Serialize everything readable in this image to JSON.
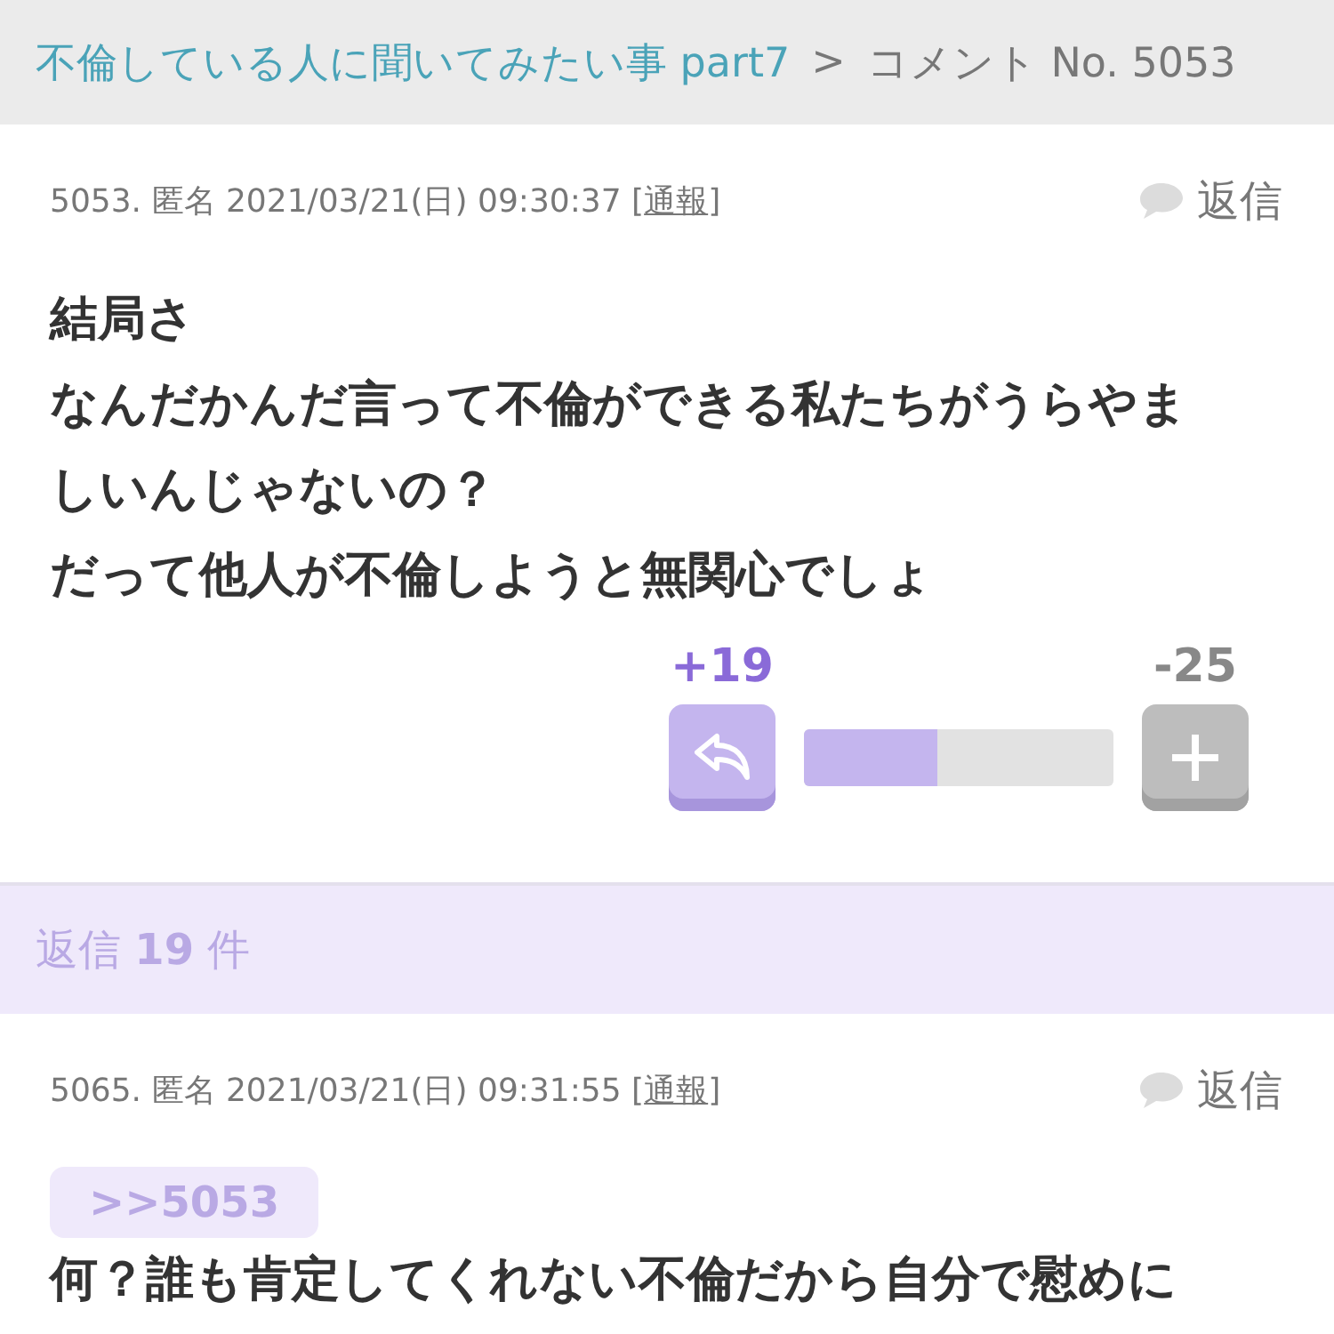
{
  "breadcrumb": {
    "thread": "不倫している人に聞いてみたい事 part7",
    "separator": ">",
    "current": "コメント No. 5053"
  },
  "comment": {
    "meta": "5053. 匿名 2021/03/21(日) 09:30:37 [",
    "report_link": "通報",
    "meta_end": "]",
    "reply_button": "返信",
    "lines": [
      "結局さ",
      "なんだかんだ言って不倫ができる私たちがうらやま",
      "しいんじゃないの？",
      "だって他人が不倫しようと無関心でしょ"
    ],
    "votes": {
      "plus": "+19",
      "minus": "-25",
      "level": 0.43
    }
  },
  "replies_bar": {
    "label": "返信 **19** 件"
  },
  "reply": {
    "meta": "5065. 匿名 2021/03/21(日) 09:31:55 [",
    "report_link": "通報",
    "meta_end": "]",
    "reply_button": "返信",
    "quote": ">>5053",
    "lines": [
      "何？誰も肯定してくれない不倫だから自分で慰めに"
    ]
  }
}
